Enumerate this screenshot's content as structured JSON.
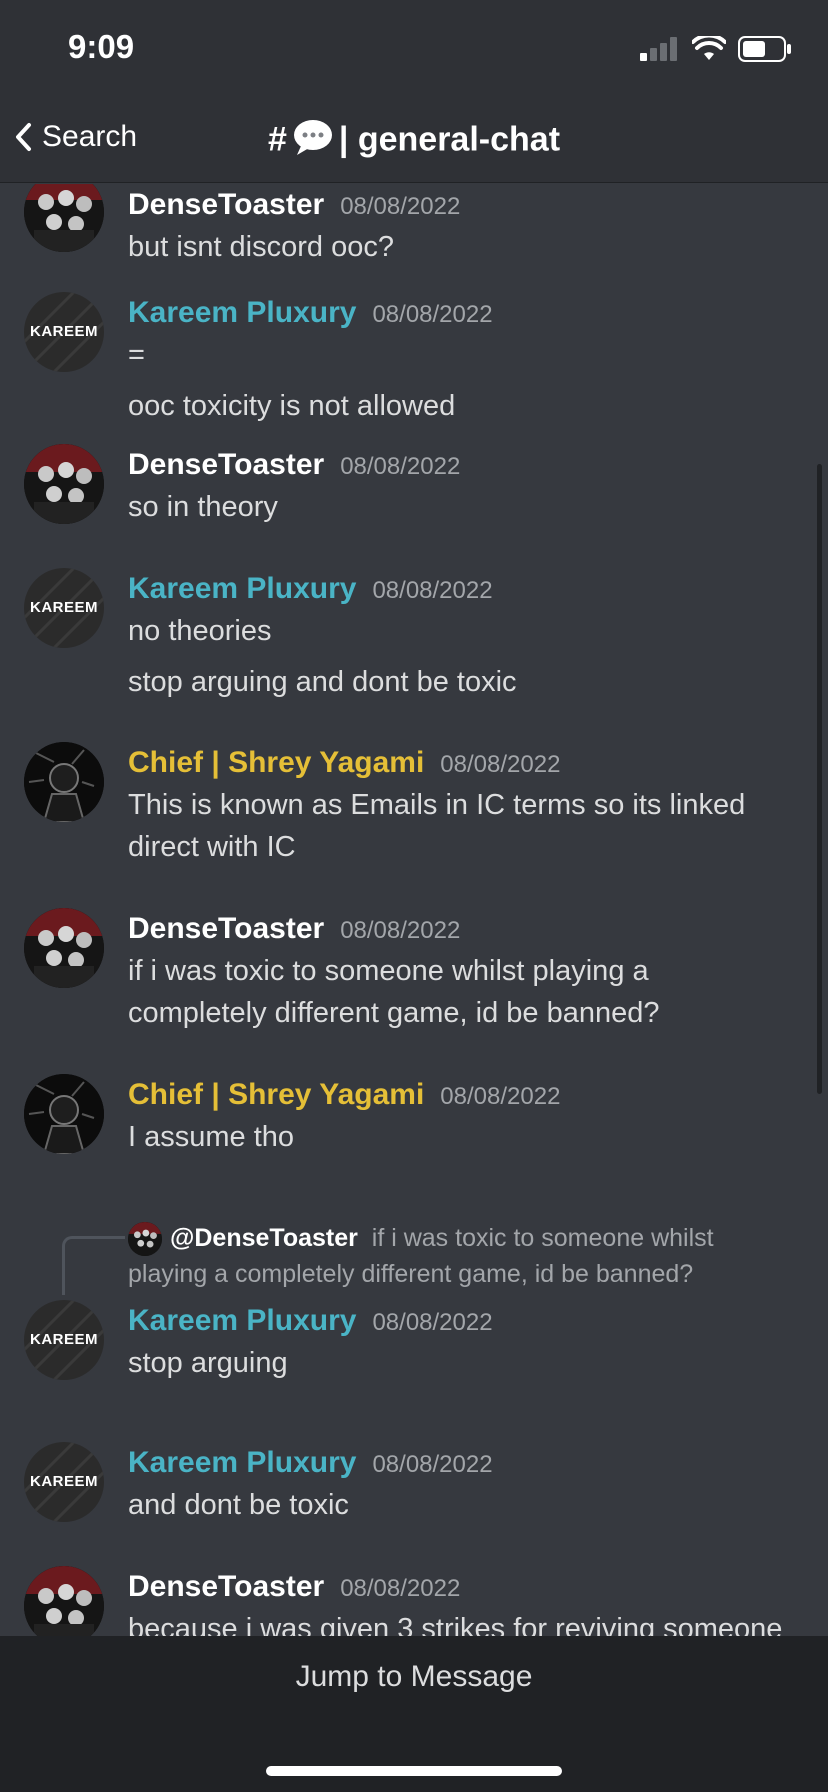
{
  "status_bar": {
    "time": "9:09"
  },
  "header": {
    "back_label": "Search",
    "channel_prefix": "#",
    "channel_name": "| general-chat"
  },
  "messages": [
    {
      "author": "DenseToaster",
      "timestamp": "08/08/2022",
      "lines": [
        "but isnt discord ooc?"
      ]
    },
    {
      "author": "Kareem Pluxury",
      "timestamp": "08/08/2022",
      "lines": [
        "=",
        "ooc toxicity is not allowed"
      ]
    },
    {
      "author": "DenseToaster",
      "timestamp": "08/08/2022",
      "lines": [
        "so in theory"
      ]
    },
    {
      "author": "Kareem Pluxury",
      "timestamp": "08/08/2022",
      "lines": [
        "no theories",
        "stop arguing and dont be toxic"
      ]
    },
    {
      "author": "Chief | Shrey Yagami",
      "timestamp": "08/08/2022",
      "lines": [
        "This is known as Emails in IC terms so its linked direct with IC"
      ]
    },
    {
      "author": "DenseToaster",
      "timestamp": "08/08/2022",
      "lines": [
        "if i was toxic to someone whilst playing a completely different game, id be banned?"
      ]
    },
    {
      "author": "Chief | Shrey Yagami",
      "timestamp": "08/08/2022",
      "lines": [
        "I assume tho"
      ]
    },
    {
      "author": "Kareem Pluxury",
      "timestamp": "08/08/2022",
      "lines": [
        "stop arguing"
      ],
      "reply": {
        "mention": "@DenseToaster",
        "text": "if i was toxic to someone whilst playing a completely different game, id be banned?"
      }
    },
    {
      "author": "Kareem Pluxury",
      "timestamp": "08/08/2022",
      "lines": [
        "and dont be toxic"
      ]
    },
    {
      "author": "DenseToaster",
      "timestamp": "08/08/2022",
      "lines": [
        "because i was given 3 strikes for reviving someone"
      ]
    }
  ],
  "avatar_text": {
    "kareem": "KAREEM"
  },
  "footer": {
    "jump_label": "Jump to Message"
  },
  "colors": {
    "background": "#36393f",
    "header": "#2f3136",
    "footer": "#202225",
    "name_dense": "#ffffff",
    "name_kareem": "#4ab4c6",
    "name_chief": "#e5bf37"
  }
}
